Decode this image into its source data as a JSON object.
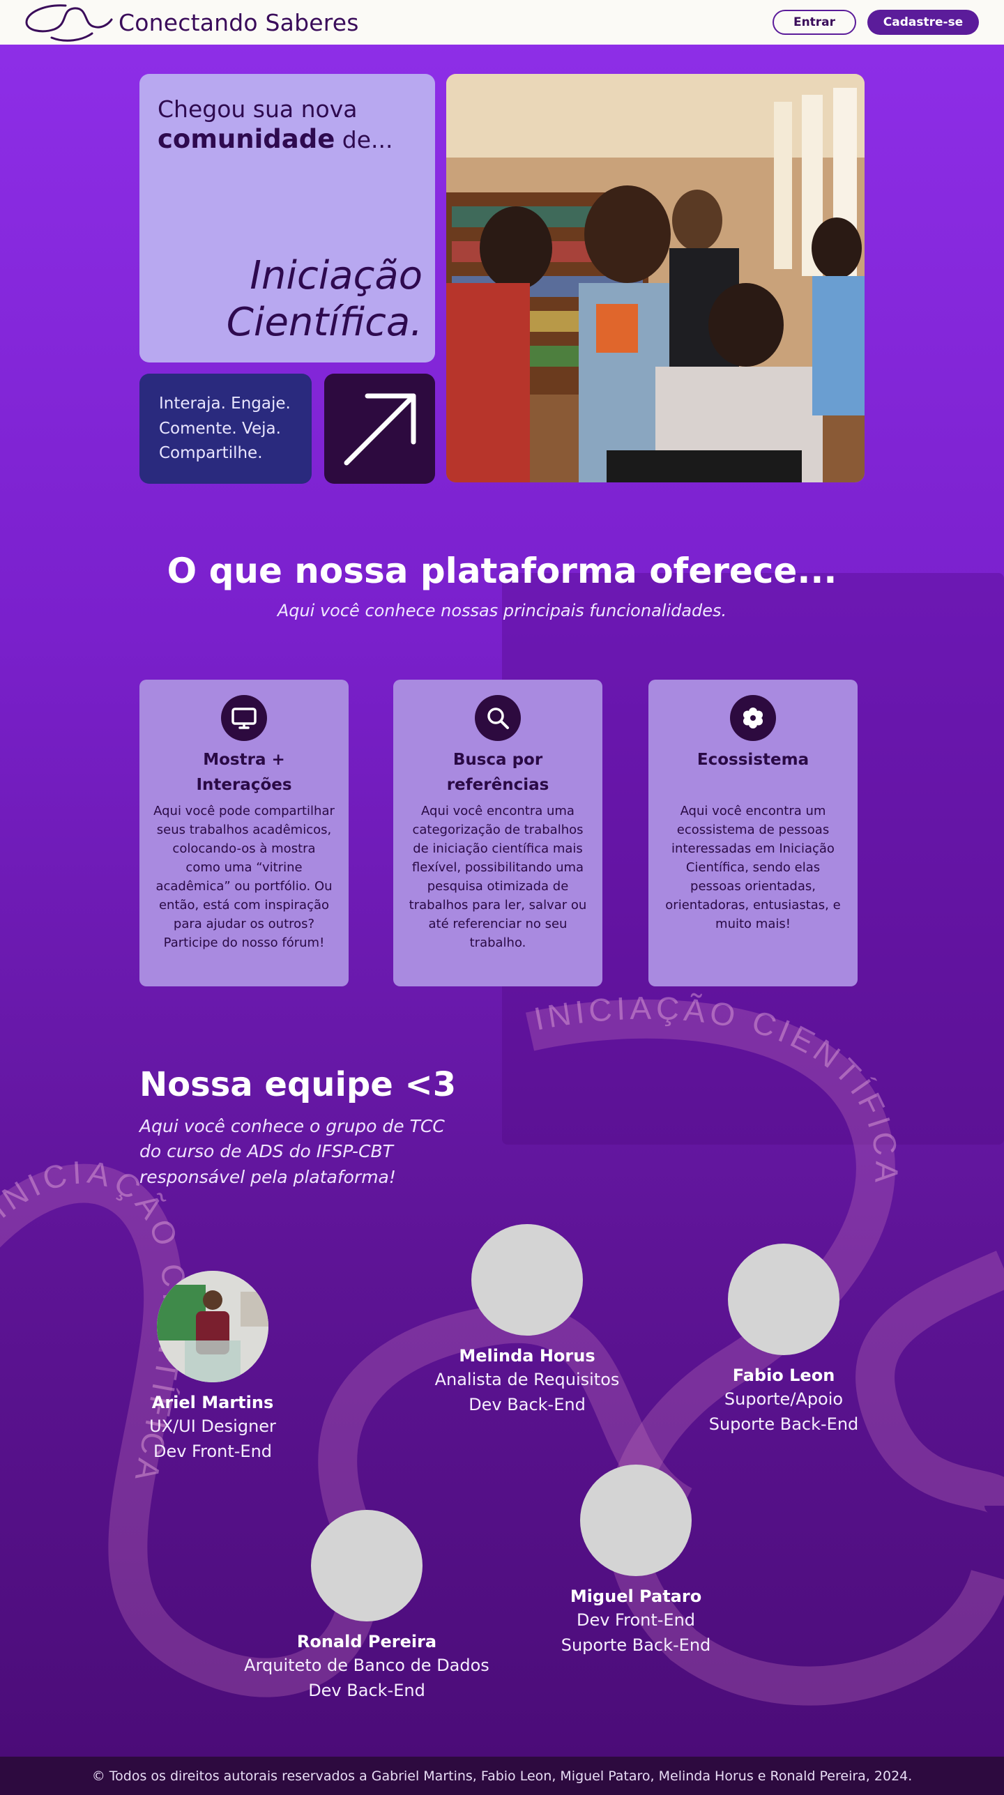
{
  "header": {
    "brand": "Conectando Saberes",
    "login_label": "Entrar",
    "signup_label": "Cadastre-se"
  },
  "hero": {
    "lead_line1": "Chegou sua nova",
    "lead_bold": "comunidade",
    "lead_rest": " de...",
    "title_line1": "Iniciação",
    "title_line2": "Científica.",
    "tagline_lines": [
      "Interaja. Engaje.",
      "Comente. Veja.",
      "Compartilhe."
    ],
    "arrow_icon": "arrow-up-right-icon",
    "photo": "students-library-photo"
  },
  "features": {
    "title": "O que nossa plataforma oferece...",
    "subtitle": "Aqui você conhece nossas principais funcionalidades.",
    "items": [
      {
        "icon": "monitor-icon",
        "title": "Mostra + Interações",
        "text": "Aqui você pode compartilhar seus trabalhos acadêmicos, colocando-os à mostra como uma “vitrine acadêmica” ou portfólio. Ou então, está com inspiração para ajudar os outros? Participe do nosso fórum!"
      },
      {
        "icon": "search-icon",
        "title": "Busca por referências",
        "text": "Aqui você encontra uma categorização de trabalhos de iniciação científica mais flexível, possibilitando uma pesquisa otimizada de trabalhos para ler, salvar ou até referenciar no seu trabalho."
      },
      {
        "icon": "flower-icon",
        "title": "Ecossistema",
        "text": "Aqui você encontra um ecossistema de pessoas interessadas em Iniciação Científica, sendo elas pessoas orientadas, orientadoras, entusiastas, e muito mais!"
      }
    ]
  },
  "decor_text": "INICIAÇÃO CIENTÍFICA",
  "team": {
    "title": "Nossa equipe <3",
    "subtitle": "Aqui você conhece o grupo de TCC do curso de ADS do IFSP-CBT responsável pela plataforma!",
    "members": [
      {
        "name": "Ariel Martins",
        "role1": "UX/UI Designer",
        "role2": "Dev Front-End"
      },
      {
        "name": "Melinda Horus",
        "role1": "Analista de Requisitos",
        "role2": "Dev Back-End"
      },
      {
        "name": "Fabio Leon",
        "role1": "Suporte/Apoio",
        "role2": "Suporte Back-End"
      },
      {
        "name": "Miguel Pataro",
        "role1": "Dev Front-End",
        "role2": "Suporte Back-End"
      },
      {
        "name": "Ronald Pereira",
        "role1": "Arquiteto de Banco de Dados",
        "role2": "Dev Back-End"
      }
    ]
  },
  "footer": {
    "copyright": "© Todos os direitos autorais reservados a Gabriel Martins, Fabio Leon, Miguel Pataro, Melinda Horus e Ronald Pereira, 2024."
  },
  "colors": {
    "header_bg": "#fbfaf6",
    "primary": "#5b1c9a",
    "hero_card": "#b8a8f0",
    "tagline_card": "#2a2a7e",
    "dark": "#2d0a3f",
    "feature_card": "#a98ae0"
  }
}
